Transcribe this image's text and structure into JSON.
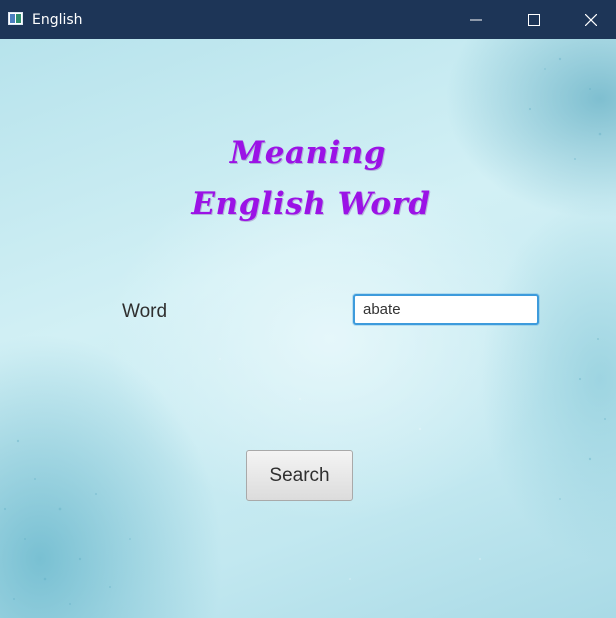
{
  "window": {
    "title": "English",
    "icons": {
      "app": "app-window-icon",
      "minimize": "minimize-icon",
      "maximize": "maximize-icon",
      "close": "close-icon"
    },
    "titlebar_color": "#1d3557"
  },
  "header": {
    "line1": "Meaning",
    "line2": "English Word",
    "color": "#9b12e6"
  },
  "form": {
    "word_label": "Word",
    "word_value": "abate",
    "search_label": "Search"
  }
}
